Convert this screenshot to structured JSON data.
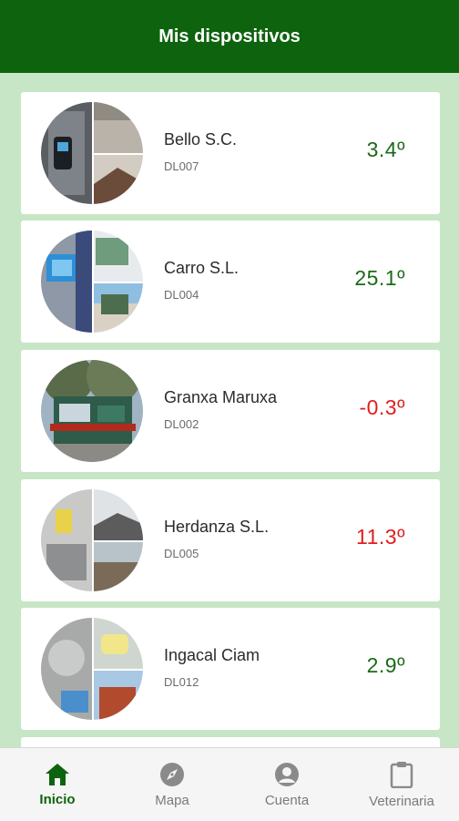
{
  "header": {
    "title": "Mis dispositivos"
  },
  "devices": [
    {
      "name": "Bello S.C.",
      "code": "DL007",
      "temp": "3.4º",
      "status": "ok"
    },
    {
      "name": "Carro S.L.",
      "code": "DL004",
      "temp": "25.1º",
      "status": "ok"
    },
    {
      "name": "Granxa Maruxa",
      "code": "DL002",
      "temp": "-0.3º",
      "status": "alert"
    },
    {
      "name": "Herdanza S.L.",
      "code": "DL005",
      "temp": "11.3º",
      "status": "alert"
    },
    {
      "name": "Ingacal Ciam",
      "code": "DL012",
      "temp": "2.9º",
      "status": "ok"
    }
  ],
  "nav": [
    {
      "label": "Inicio",
      "icon": "home-icon",
      "active": true
    },
    {
      "label": "Mapa",
      "icon": "compass-icon",
      "active": false
    },
    {
      "label": "Cuenta",
      "icon": "account-icon",
      "active": false
    },
    {
      "label": "Veterinaria",
      "icon": "clipboard-icon",
      "active": false
    }
  ],
  "colors": {
    "primary": "#0e630e",
    "background": "#c7e6c5",
    "temp_ok": "#1b6a17",
    "temp_alert": "#e01d1d"
  }
}
